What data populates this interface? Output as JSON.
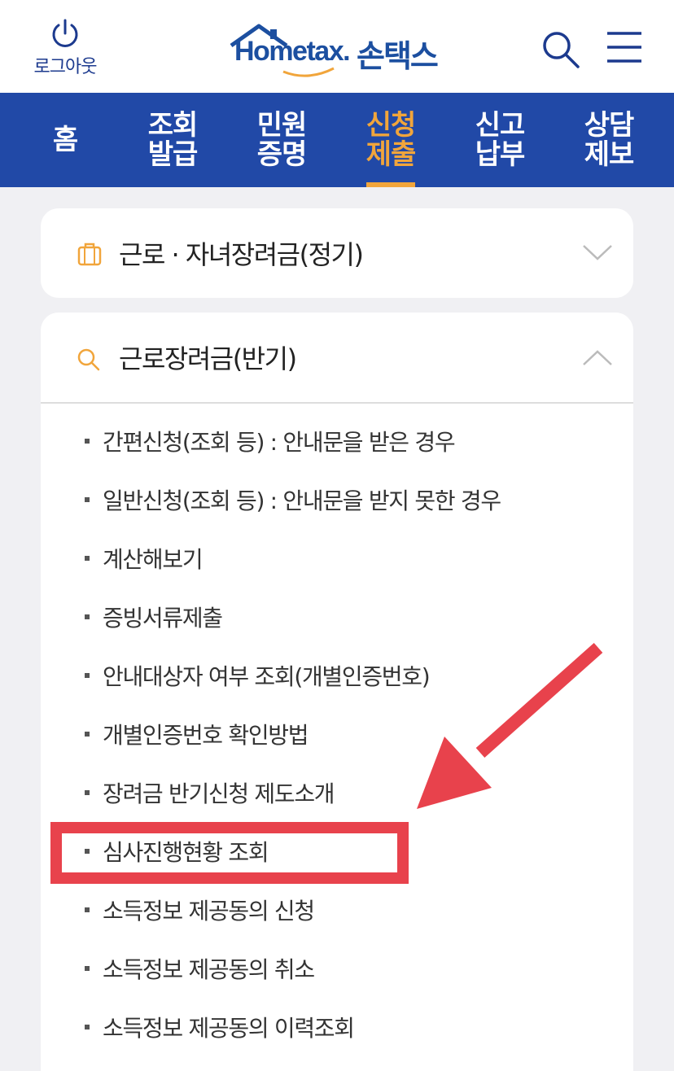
{
  "header": {
    "logout_label": "로그아웃",
    "logo_text": "Hometax.",
    "logo_korean": "손택스",
    "search_icon": "search-icon",
    "menu_icon": "hamburger-menu-icon"
  },
  "nav": {
    "tabs": [
      {
        "label": "홈",
        "active": false
      },
      {
        "label": "조회 발급",
        "active": false
      },
      {
        "label": "민원 증명",
        "active": false
      },
      {
        "label": "신청 제출",
        "active": true
      },
      {
        "label": "신고 납부",
        "active": false
      },
      {
        "label": "상담 제보",
        "active": false
      }
    ]
  },
  "section1": {
    "icon": "briefcase-icon",
    "title": "근로 · 자녀장려금(정기)",
    "expanded": false
  },
  "section2": {
    "icon": "search-icon",
    "title": "근로장려금(반기)",
    "expanded": true,
    "items": [
      "간편신청(조회 등) : 안내문을 받은 경우",
      "일반신청(조회 등) : 안내문을 받지 못한 경우",
      "계산해보기",
      "증빙서류제출",
      "안내대상자 여부 조회(개별인증번호)",
      "개별인증번호 확인방법",
      "장려금 반기신청 제도소개",
      "심사진행현황 조회",
      "소득정보 제공동의 신청",
      "소득정보 제공동의 취소",
      "소득정보 제공동의 이력조회"
    ]
  },
  "annotation": {
    "highlighted_item": "심사진행현황 조회",
    "color": "#e8424c"
  },
  "colors": {
    "brand_blue": "#2149a7",
    "active_orange": "#f1a53b",
    "background": "#f0f0f3"
  }
}
